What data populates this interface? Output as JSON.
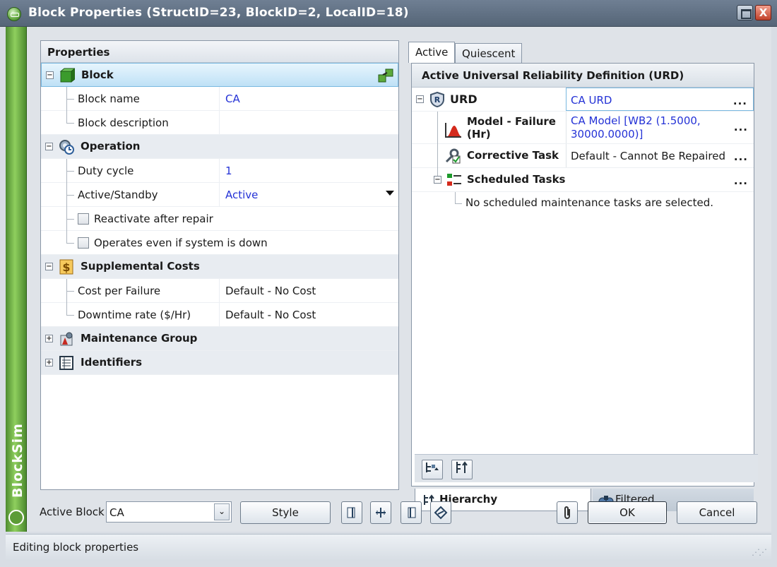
{
  "window": {
    "title": "Block Properties (StructID=23, BlockID=2, LocalID=18)",
    "close_label": "X"
  },
  "brand": {
    "name": "BlockSim"
  },
  "properties": {
    "header": "Properties",
    "categories": [
      {
        "name": "Block",
        "icon": "block-icon",
        "expanded": true,
        "rows": [
          {
            "label": "Block name",
            "value": "CA",
            "value_color": "#2432d6"
          },
          {
            "label": "Block description",
            "value": ""
          }
        ]
      },
      {
        "name": "Operation",
        "icon": "operation-icon",
        "expanded": true,
        "rows": [
          {
            "label": "Duty cycle",
            "value": "1",
            "value_color": "#2432d6"
          },
          {
            "label": "Active/Standby",
            "value": "Active",
            "value_color": "#2432d6"
          }
        ],
        "checks": [
          "Reactivate after repair",
          "Operates even if system is down"
        ]
      },
      {
        "name": "Supplemental Costs",
        "icon": "dollar-icon",
        "expanded": true,
        "rows": [
          {
            "label": "Cost per Failure",
            "value": "Default - No Cost"
          },
          {
            "label": "Downtime rate ($/Hr)",
            "value": "Default - No Cost"
          }
        ]
      },
      {
        "name": "Maintenance Group",
        "icon": "maintenance-group-icon",
        "expanded": false
      },
      {
        "name": "Identifiers",
        "icon": "identifiers-icon",
        "expanded": false
      }
    ]
  },
  "right": {
    "tabs": [
      "Active",
      "Quiescent"
    ],
    "urd_header": "Active Universal Reliability Definition (URD)",
    "urd": {
      "label": "URD",
      "value": "CA URD"
    },
    "items": [
      {
        "label": "Model - Failure (Hr)",
        "value": "CA Model [WB2 (1.5000, 30000.0000)]",
        "value_color": "#2432d6"
      },
      {
        "label": "Corrective Task",
        "value": "Default - Cannot Be Repaired"
      },
      {
        "label": "Scheduled Tasks",
        "value": ""
      }
    ],
    "note": "No scheduled maintenance tasks are selected.",
    "subtabs": [
      "Hierarchy",
      "Filtered"
    ],
    "more": "..."
  },
  "bottom": {
    "active_block_label": "Active Block",
    "active_block_value": "CA",
    "style_button": "Style",
    "ok_button": "OK",
    "cancel_button": "Cancel"
  },
  "status": "Editing block properties"
}
